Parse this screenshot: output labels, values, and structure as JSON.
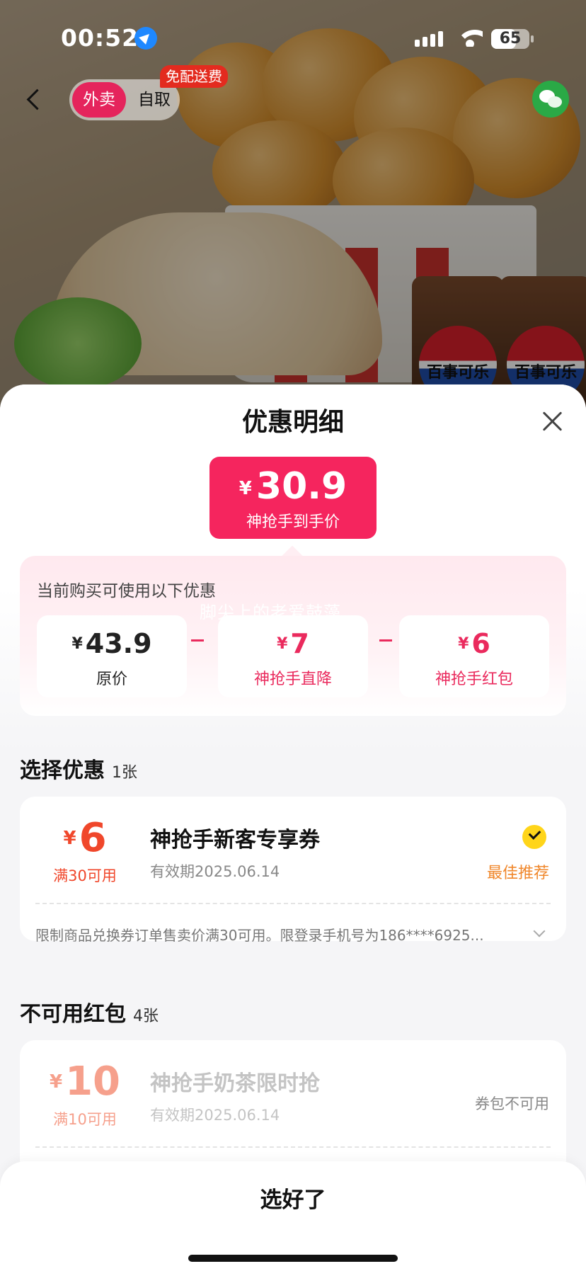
{
  "status_bar": {
    "time": "00:52",
    "battery": "65",
    "battery_level": 0.65
  },
  "nav": {
    "seg_delivery": "外卖",
    "seg_pickup": "自取",
    "free_tag": "免配送费"
  },
  "hero": {
    "cup_brand": "百事可乐"
  },
  "sheet": {
    "title": "优惠明细",
    "final_price": {
      "currency": "¥",
      "value": "30.9",
      "label": "神抢手到手价"
    },
    "calc": {
      "hint": "当前购买可使用以下优惠",
      "watermark": "脚尖上的老爱鼓藻",
      "items": [
        {
          "currency": "¥",
          "value": "43.9",
          "label": "原价"
        },
        {
          "currency": "¥",
          "value": "7",
          "label": "神抢手直降"
        },
        {
          "currency": "¥",
          "value": "6",
          "label": "神抢手红包"
        }
      ]
    },
    "choose": {
      "title": "选择优惠",
      "count": "1张"
    },
    "selected_coupon": {
      "currency": "¥",
      "amount": "6",
      "condition": "满30可用",
      "name": "神抢手新客专享券",
      "expiry": "有效期2025.06.14",
      "badge": "最佳推荐",
      "limit": "限制商品兑换券订单售卖价满30可用。限登录手机号为186****6925..."
    },
    "unavailable": {
      "title": "不可用红包",
      "count": "4张"
    },
    "unavailable_coupon": {
      "currency": "¥",
      "amount": "10",
      "condition": "满10可用",
      "name": "神抢手奶茶限时抢",
      "expiry": "有效期2025.06.14",
      "status": "券包不可用"
    },
    "confirm": "选好了"
  }
}
